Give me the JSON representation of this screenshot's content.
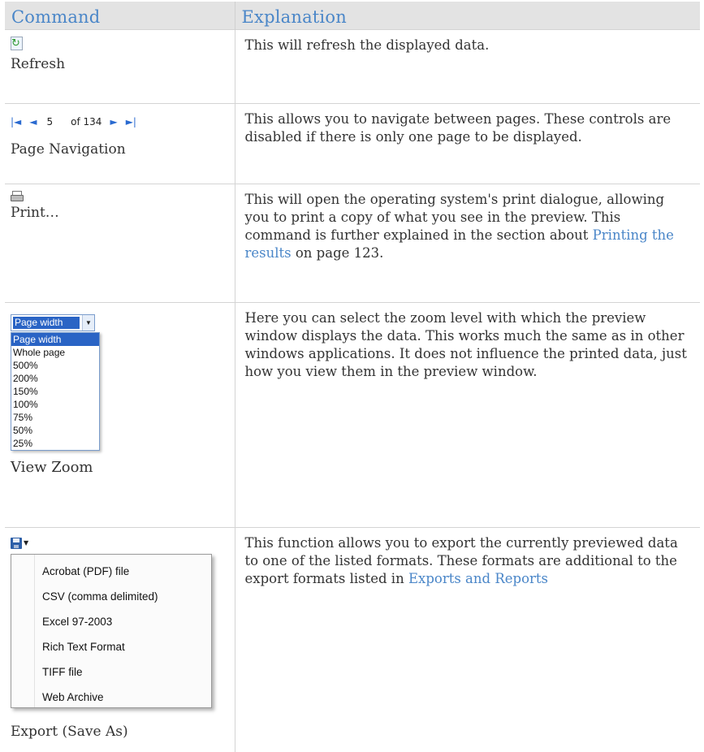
{
  "header": {
    "command": "Command",
    "explanation": "Explanation"
  },
  "rows": [
    {
      "name": "Refresh",
      "icon": "refresh-icon",
      "explanation": "This will refresh the displayed data."
    },
    {
      "name": "Page Navigation",
      "nav": {
        "first": "◄",
        "prev": "◄",
        "page": "5",
        "of_total": "of 134",
        "next": "►",
        "last": "►"
      },
      "explanation": "This allows you to navigate between pages. These controls are disabled if there is only one page to be displayed."
    },
    {
      "name": "Print…",
      "icon": "printer-icon",
      "explanation_before": "This will open the operating system's print dialogue, allowing you to print a copy of what you see in the preview. This command is further explained in the section about ",
      "explanation_link": "Printing the results",
      "explanation_after": " on page 123."
    },
    {
      "name": "View Zoom",
      "zoom": {
        "selected": "Page width",
        "options": [
          "Page width",
          "Whole page",
          "500%",
          "200%",
          "150%",
          "100%",
          "75%",
          "50%",
          "25%"
        ]
      },
      "explanation": "Here you can select the zoom level with which the preview window displays the data. This works much the same as in other windows applications. It does not influence the printed data, just how you view them in the preview window."
    },
    {
      "name": "Export (Save As)",
      "icon": "save-icon",
      "menu": [
        "Acrobat (PDF) file",
        "CSV (comma delimited)",
        "Excel 97-2003",
        "Rich Text Format",
        "TIFF file",
        "Web Archive"
      ],
      "explanation_before": "This function allows you to export the currently previewed data to one of the listed formats. These formats are additional to the export formats listed in ",
      "explanation_link": "Exports and Reports"
    }
  ],
  "colors": {
    "header_bg": "#e3e3e3",
    "header_text": "#4a86c8",
    "link": "#4a86c8",
    "selection": "#2a64c5"
  }
}
